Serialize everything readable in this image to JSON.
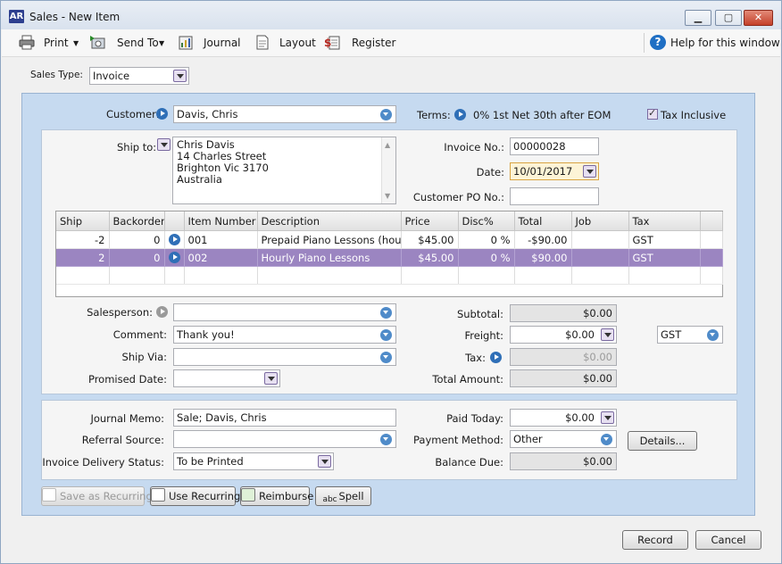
{
  "window": {
    "app_icon_text": "AR",
    "title": "Sales - New Item"
  },
  "toolbar": {
    "print": "Print",
    "send_to": "Send To",
    "journal": "Journal",
    "layout": "Layout",
    "register": "Register",
    "help": "Help for this window"
  },
  "sales_type": {
    "label": "Sales Type:",
    "value": "Invoice"
  },
  "header": {
    "customer_label": "Customer:",
    "customer_value": "Davis, Chris",
    "terms_label": "Terms:",
    "terms_value": "0% 1st Net 30th after EOM",
    "tax_inclusive_label": "Tax Inclusive"
  },
  "shipping": {
    "ship_to_label": "Ship to:",
    "lines": [
      "Chris Davis",
      "14 Charles Street",
      "Brighton  Vic  3170",
      "Australia"
    ]
  },
  "invoice": {
    "invoice_no_label": "Invoice No.:",
    "invoice_no": "00000028",
    "date_label": "Date:",
    "date": "10/01/2017",
    "customer_po_label": "Customer PO No.:",
    "customer_po": ""
  },
  "table": {
    "columns": [
      "Ship",
      "Backorder",
      "",
      "Item Number",
      "Description",
      "Price",
      "Disc%",
      "Total",
      "Job",
      "Tax"
    ],
    "rows": [
      {
        "ship": "-2",
        "backorder": "0",
        "item": "001",
        "description": "Prepaid Piano Lessons (hours)",
        "price": "$45.00",
        "disc": "0 %",
        "total": "-$90.00",
        "job": "",
        "tax": "GST"
      },
      {
        "ship": "2",
        "backorder": "0",
        "item": "002",
        "description": "Hourly Piano Lessons",
        "price": "$45.00",
        "disc": "0 %",
        "total": "$90.00",
        "job": "",
        "tax": "GST"
      }
    ]
  },
  "details": {
    "salesperson_label": "Salesperson:",
    "salesperson": "",
    "comment_label": "Comment:",
    "comment": "Thank you!",
    "ship_via_label": "Ship Via:",
    "ship_via": "",
    "promised_date_label": "Promised Date:",
    "promised_date": ""
  },
  "totals": {
    "subtotal_label": "Subtotal:",
    "subtotal": "$0.00",
    "freight_label": "Freight:",
    "freight": "$0.00",
    "freight_tax": "GST",
    "tax_label": "Tax:",
    "tax": "$0.00",
    "total_label": "Total Amount:",
    "total": "$0.00"
  },
  "footer": {
    "journal_memo_label": "Journal Memo:",
    "journal_memo": "Sale; Davis, Chris",
    "referral_label": "Referral Source:",
    "referral": "",
    "delivery_label": "Invoice Delivery Status:",
    "delivery": "To be Printed",
    "paid_today_label": "Paid Today:",
    "paid_today": "$0.00",
    "payment_method_label": "Payment Method:",
    "payment_method": "Other",
    "details_button": "Details...",
    "balance_due_label": "Balance Due:",
    "balance_due": "$0.00"
  },
  "actions": {
    "save_recurring": "Save as Recurring",
    "use_recurring": "Use Recurring",
    "reimburse": "Reimburse",
    "spell": "Spell",
    "record": "Record",
    "cancel": "Cancel"
  },
  "colors": {
    "accent_purple": "#9b85c1",
    "panel_blue": "#c6daf0"
  }
}
